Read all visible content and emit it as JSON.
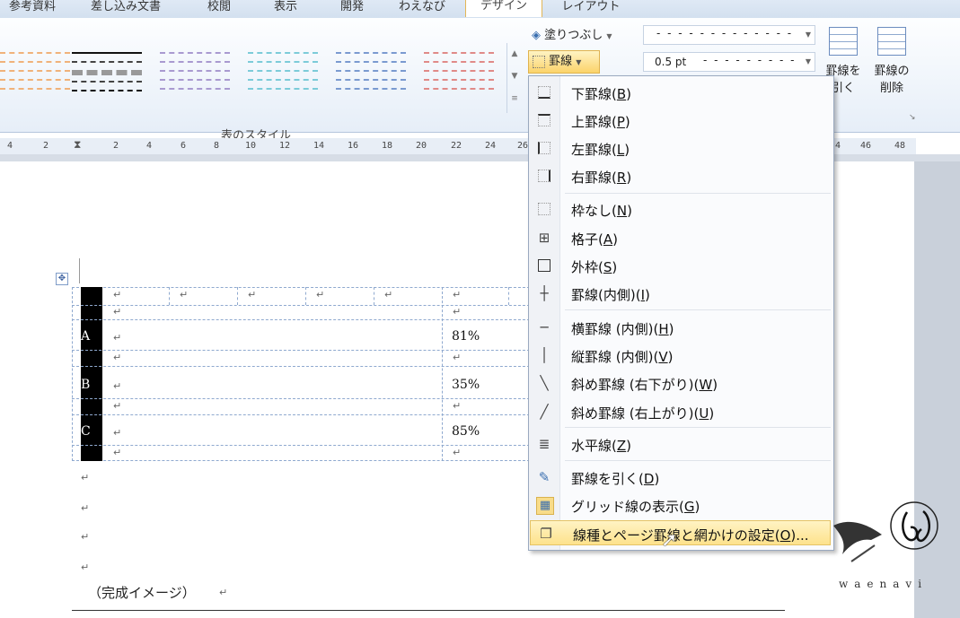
{
  "tabs": [
    "参考資料",
    "差し込み文書",
    "校閲",
    "表示",
    "開発",
    "わえなび",
    "デザイン",
    "レイアウト"
  ],
  "ribbon": {
    "group_label": "表のスタイル",
    "shading_label": "塗りつぶし",
    "borders_label": "罫線",
    "line_weight": "0.5 pt",
    "draw_table_label": [
      "罫線を",
      "引く"
    ],
    "eraser_label": [
      "罫線の",
      "削除"
    ]
  },
  "ruler": {
    "left_ticks": [
      "4",
      "2"
    ],
    "ticks": [
      "2",
      "4",
      "6",
      "8",
      "10",
      "12",
      "14",
      "16",
      "18",
      "20",
      "22",
      "24",
      "26"
    ],
    "right_ticks": [
      "4",
      "46",
      "48"
    ]
  },
  "document": {
    "row_labels": [
      "A",
      "B",
      "C"
    ],
    "percent_values": [
      "81%",
      "35%",
      "85%"
    ],
    "mark": "↵",
    "caption": "（完成イメージ）"
  },
  "menu": {
    "items": [
      {
        "text": "下罫線",
        "key": "B",
        "icon": "bottom-border-icon"
      },
      {
        "text": "上罫線",
        "key": "P",
        "icon": "top-border-icon"
      },
      {
        "text": "左罫線",
        "key": "L",
        "icon": "left-border-icon"
      },
      {
        "text": "右罫線",
        "key": "R",
        "icon": "right-border-icon"
      },
      {
        "text": "枠なし",
        "key": "N",
        "icon": "no-border-icon"
      },
      {
        "text": "格子",
        "key": "A",
        "icon": "all-borders-icon"
      },
      {
        "text": "外枠",
        "key": "S",
        "icon": "outside-borders-icon"
      },
      {
        "text": "罫線(内側)",
        "key": "I",
        "icon": "inside-borders-icon"
      },
      {
        "text": "横罫線 (内側)",
        "key": "H",
        "icon": "inside-horizontal-border-icon"
      },
      {
        "text": "縦罫線 (内側)",
        "key": "V",
        "icon": "inside-vertical-border-icon"
      },
      {
        "text": "斜め罫線 (右下がり)",
        "key": "W",
        "icon": "diagonal-down-border-icon"
      },
      {
        "text": "斜め罫線 (右上がり)",
        "key": "U",
        "icon": "diagonal-up-border-icon"
      },
      {
        "text": "水平線",
        "key": "Z",
        "icon": "horizontal-line-icon"
      },
      {
        "text": "罫線を引く",
        "key": "D",
        "icon": "draw-table-icon"
      },
      {
        "text": "グリッド線の表示",
        "key": "G",
        "icon": "view-gridlines-icon"
      },
      {
        "text": "線種とページ罫線と網かけの設定",
        "key": "O",
        "suffix": "...",
        "icon": "borders-shading-icon"
      }
    ]
  },
  "logo_text": "waenavi"
}
